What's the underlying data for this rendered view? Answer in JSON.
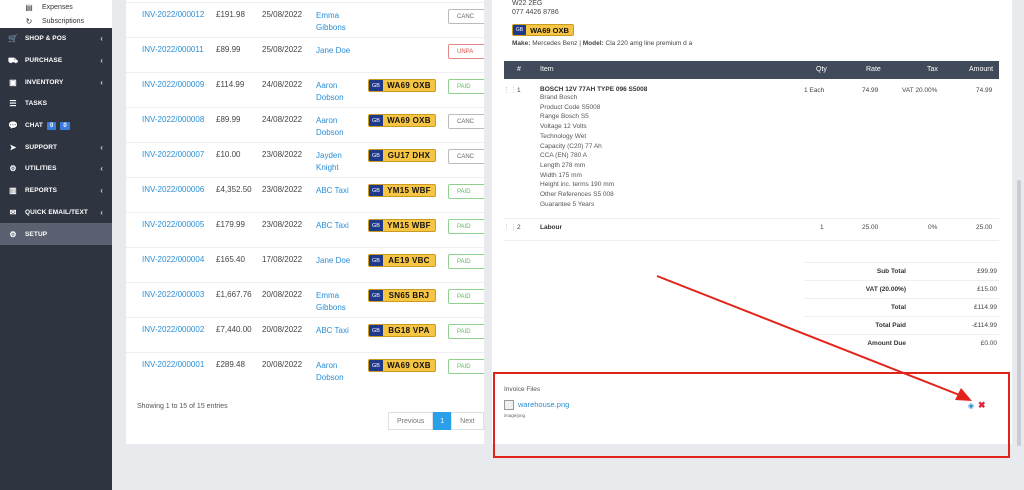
{
  "sidebar": {
    "sub_items": [
      {
        "label": "Expenses",
        "icon": "receipt-icon"
      },
      {
        "label": "Subscriptions",
        "icon": "refresh-icon"
      }
    ],
    "items": [
      {
        "label": "SHOP & POS",
        "icon": "cart-icon",
        "chevron": true
      },
      {
        "label": "PURCHASE",
        "icon": "truck-icon",
        "chevron": true
      },
      {
        "label": "INVENTORY",
        "icon": "cube-icon",
        "chevron": true
      },
      {
        "label": "TASKS",
        "icon": "list-icon",
        "chevron": false
      },
      {
        "label": "CHAT",
        "icon": "chat-icon",
        "chevron": false,
        "badges": [
          "0",
          "0"
        ]
      },
      {
        "label": "SUPPORT",
        "icon": "plane-icon",
        "chevron": true
      },
      {
        "label": "UTILITIES",
        "icon": "cogs-icon",
        "chevron": true
      },
      {
        "label": "REPORTS",
        "icon": "chart-icon",
        "chevron": true
      },
      {
        "label": "QUICK EMAIL/TEXT",
        "icon": "envelope-icon",
        "chevron": true
      },
      {
        "label": "SETUP",
        "icon": "gear-icon",
        "chevron": false,
        "active": true
      }
    ]
  },
  "invoices": [
    {
      "number": "INV-2022/000012",
      "amount": "£191.98",
      "date": "25/08/2022",
      "customer": "Emma Gibbons",
      "plate": "",
      "status": "CANC"
    },
    {
      "number": "INV-2022/000011",
      "amount": "£89.99",
      "date": "25/08/2022",
      "customer": "Jane Doe",
      "plate": "",
      "status": "UNPA"
    },
    {
      "number": "INV-2022/000009",
      "amount": "£114.99",
      "date": "24/08/2022",
      "customer": "Aaron Dobson",
      "plate": "WA69 OXB",
      "status": "PAID"
    },
    {
      "number": "INV-2022/000008",
      "amount": "£89.99",
      "date": "24/08/2022",
      "customer": "Aaron Dobson",
      "plate": "WA69 OXB",
      "status": "CANC"
    },
    {
      "number": "INV-2022/000007",
      "amount": "£10.00",
      "date": "23/08/2022",
      "customer": "Jayden Knight",
      "plate": "GU17 DHX",
      "status": "CANC"
    },
    {
      "number": "INV-2022/000006",
      "amount": "£4,352.50",
      "date": "23/08/2022",
      "customer": "ABC Taxi",
      "plate": "YM15 WBF",
      "status": "PAID"
    },
    {
      "number": "INV-2022/000005",
      "amount": "£179.99",
      "date": "23/08/2022",
      "customer": "ABC Taxi",
      "plate": "YM15 WBF",
      "status": "PAID"
    },
    {
      "number": "INV-2022/000004",
      "amount": "£165.40",
      "date": "17/08/2022",
      "customer": "Jane Doe",
      "plate": "AE19 VBC",
      "status": "PAID"
    },
    {
      "number": "INV-2022/000003",
      "amount": "£1,667.76",
      "date": "20/08/2022",
      "customer": "Emma Gibbons",
      "plate": "SN65 BRJ",
      "status": "PAID"
    },
    {
      "number": "INV-2022/000002",
      "amount": "£7,440.00",
      "date": "20/08/2022",
      "customer": "ABC Taxi",
      "plate": "BG18 VPA",
      "status": "PAID"
    },
    {
      "number": "INV-2022/000001",
      "amount": "£289.48",
      "date": "20/08/2022",
      "customer": "Aaron Dobson",
      "plate": "WA69 OXB",
      "status": "PAID"
    }
  ],
  "plate_country": "GB",
  "table_footer": {
    "showing": "Showing 1 to 15 of 15 entries",
    "prev": "Previous",
    "page": "1",
    "next": "Next"
  },
  "invoice_detail": {
    "postcode": "W22 2EG",
    "phone": "077 4426 8786",
    "plate": "WA69 OXB",
    "make_label": "Make:",
    "make_value": "Mercedes Benz",
    "model_label": "Model:",
    "model_value": "Cla 220 amg line premium d a",
    "headers": {
      "num": "#",
      "item": "Item",
      "qty": "Qty",
      "rate": "Rate",
      "tax": "Tax",
      "amount": "Amount"
    },
    "items": [
      {
        "num": "1",
        "name": "BOSCH 12V 77AH TYPE 096 S5008",
        "desc": [
          "Brand Bosch",
          "Product Code S5008",
          "Range Bosch S5",
          "Voltage 12 Volts",
          "Technology Wet",
          "Capacity (C20) 77 Ah",
          "CCA (EN) 780 A",
          "Length 278 mm",
          "Width 175 mm",
          "Height inc. terms 190 mm",
          "Other References S5 008",
          "Guarantee 5 Years"
        ],
        "qty": "1 Each",
        "rate": "74.99",
        "tax": "VAT 20.00%",
        "amount": "74.99"
      },
      {
        "num": "2",
        "name": "Labour",
        "desc": [],
        "qty": "1",
        "rate": "25.00",
        "tax": "0%",
        "amount": "25.00"
      }
    ],
    "totals": [
      {
        "label": "Sub Total",
        "value": "£99.99"
      },
      {
        "label": "VAT (20.00%)",
        "value": "£15.00"
      },
      {
        "label": "Total",
        "value": "£114.99"
      },
      {
        "label": "Total Paid",
        "value": "-£114.99"
      },
      {
        "label": "Amount Due",
        "value": "£0.00"
      }
    ],
    "files_title": "Invoice Files",
    "file_name": "warehouse.png",
    "file_type": "image/png"
  },
  "annotation_color": "#e2231a"
}
